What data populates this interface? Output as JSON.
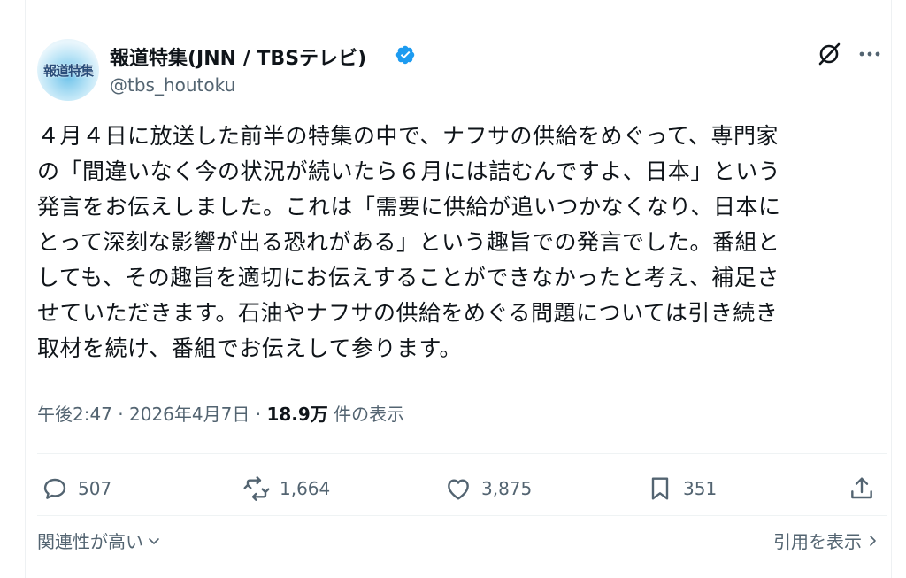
{
  "account": {
    "avatar_text": "報道特集",
    "display_name": "報道特集(JNN / TBSテレビ)",
    "handle": "@tbs_houtoku",
    "verified_icon": "verified-badge-icon"
  },
  "tweet": {
    "lines": [
      "４月４日に放送した前半の特集の中で、ナフサの供給をめぐって、専門家",
      "の「間違いなく今の状況が続いたら６月には詰むんですよ、日本」という",
      "発言をお伝えしました。これは「需要に供給が追いつかなくなり、日本に",
      "とって深刻な影響が出る恐れがある」という趣旨での発言でした。番組と",
      "しても、その趣旨を適切にお伝えすることができなかったと考え、補足さ",
      "せていただきます。石油やナフサの供給をめぐる問題については引き続き",
      "取材を続け、番組でお伝えして参ります。"
    ],
    "time": "午後2:47",
    "sep": " · ",
    "date": "2026年4月7日",
    "views_count": "18.9万",
    "views_label": "件の表示"
  },
  "actions": {
    "replies": "507",
    "reposts": "1,664",
    "likes": "3,875",
    "bookmarks": "351"
  },
  "footer": {
    "relevance_label": "関連性が高い",
    "quotes_label": "引用を表示"
  },
  "colors": {
    "text": "#0f1419",
    "muted": "#536471",
    "verified": "#1d9bf0",
    "divider": "#eff3f4"
  }
}
